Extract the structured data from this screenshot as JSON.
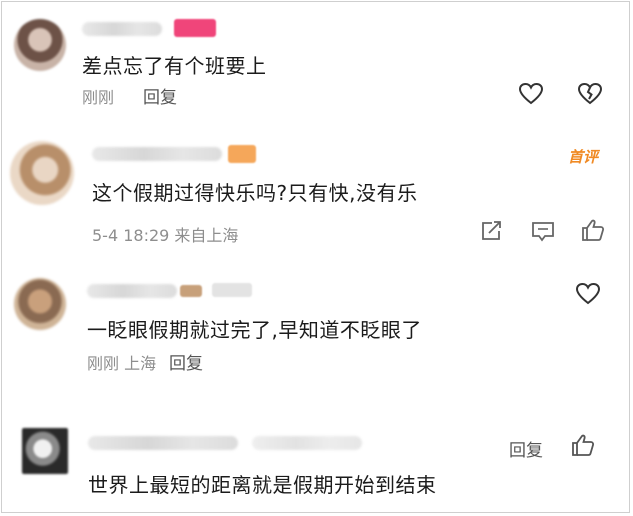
{
  "comments": [
    {
      "text": "差点忘了有个班要上",
      "time": "刚刚",
      "reply_label": "回复"
    },
    {
      "text": "这个假期过得快乐吗?只有快,没有乐",
      "time_location": "5-4 18:29 来自上海",
      "badge": "首评"
    },
    {
      "text": "一眨眼假期就过完了,早知道不眨眼了",
      "time_location": "刚刚 上海",
      "reply_label": "回复"
    },
    {
      "text": "世界上最短的距离就是假期开始到结束",
      "reply_label": "回复"
    }
  ],
  "icons": {
    "like": "heart-icon",
    "dislike": "broken-heart-icon",
    "share": "share-icon",
    "comment": "comment-icon",
    "thumb": "thumbs-up-icon"
  },
  "colors": {
    "badge_pink": "#f0457a",
    "hot_orange": "#f08a24",
    "meta_gray": "#8e8e8e"
  }
}
